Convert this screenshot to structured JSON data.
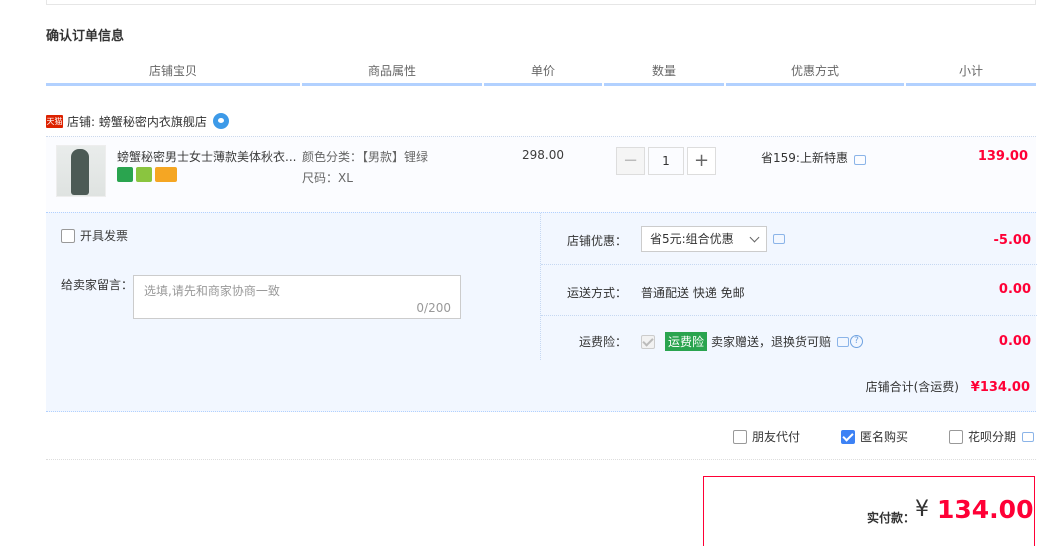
{
  "section_title": "确认订单信息",
  "columns": [
    "店铺宝贝",
    "商品属性",
    "单价",
    "数量",
    "优惠方式",
    "小计"
  ],
  "shop": {
    "badge": "天猫",
    "label": "店铺: 螃蟹秘密内衣旗舰店"
  },
  "item": {
    "name": "螃蟹秘密男士女士薄款美体秋衣...",
    "attr_color": "颜色分类：【男款】锂绿",
    "attr_size": "尺码：XL",
    "unit_price": "298.00",
    "quantity": "1",
    "qty_minus": "−",
    "qty_plus": "+",
    "promo": "省159:上新特惠",
    "subtotal": "139.00"
  },
  "invoice_label": "开具发票",
  "message": {
    "label": "给卖家留言：",
    "placeholder": "选填,请先和商家协商一致",
    "count": "0/200"
  },
  "shop_discount": {
    "label": "店铺优惠：",
    "selected": "省5元:组合优惠",
    "amount": "-5.00"
  },
  "shipping": {
    "label": "运送方式：",
    "value": "普通配送 快递 免邮",
    "amount": "0.00"
  },
  "insurance": {
    "label": "运费险：",
    "tag": "运费险",
    "value": "卖家赠送，退换货可赔",
    "help": "?",
    "amount": "0.00"
  },
  "shop_total": {
    "label": "店铺合计(含运费)",
    "amount": "¥134.00"
  },
  "options": {
    "friend_pay": "朋友代付",
    "anonymous": "匿名购买",
    "huabei": "花呗分期"
  },
  "payment": {
    "label": "实付款：",
    "currency": "¥",
    "amount": "134.00"
  },
  "colors": {
    "accent": "#ff0036",
    "header_border": "#b2d1ff",
    "panel_bg": "#f2f7ff",
    "check_blue": "#3d82f5"
  }
}
